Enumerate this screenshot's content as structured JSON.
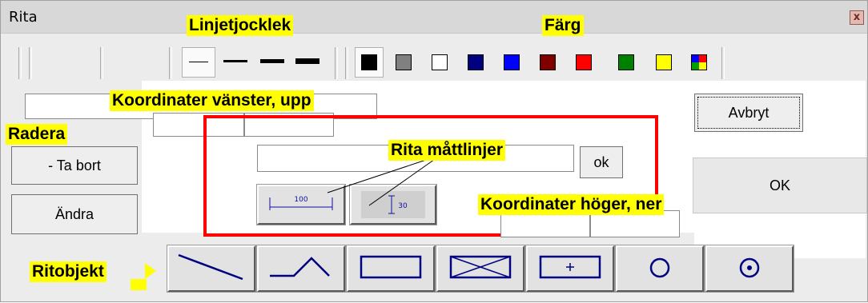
{
  "window": {
    "title": "Rita",
    "close_glyph": "x"
  },
  "callouts": {
    "line_thickness": "Linjetjocklek",
    "color": "Färg",
    "coords_left_up": "Koordinater vänster, upp",
    "delete": "Radera",
    "dimension_lines": "Rita måttlinjer",
    "coords_right_down": "Koordinater höger, ner",
    "draw_objects": "Ritobjekt"
  },
  "toolbar": {
    "line_widths": [
      "thin",
      "medium",
      "thick",
      "extra-thick"
    ],
    "colors": [
      "#000000",
      "#808080",
      "#ffffff",
      "#000080",
      "#0000ff",
      "#800000",
      "#ff0000",
      "#008000",
      "#ffff00",
      "multicolor"
    ],
    "selected_line_width": "thin",
    "selected_color": "#000000"
  },
  "buttons": {
    "cancel": "Avbryt",
    "ok": "OK",
    "delete": "- Ta bort",
    "change": "Ändra",
    "text_ok": "ok"
  },
  "fields": {
    "name_value": "",
    "text_value": "",
    "x_left": "",
    "y_up": "",
    "x_right": "",
    "y_down": ""
  },
  "dimension_tools": [
    {
      "icon": "horizontal-dimension-icon",
      "label": "100"
    },
    {
      "icon": "vertical-dimension-icon",
      "label": "30"
    }
  ],
  "draw_tools": [
    "line-icon",
    "polyline-icon",
    "rectangle-icon",
    "crossed-rectangle-icon",
    "rectangle-plus-icon",
    "circle-icon",
    "circle-dot-icon"
  ],
  "canvas": {
    "preview_border_color": "#ff0000"
  }
}
